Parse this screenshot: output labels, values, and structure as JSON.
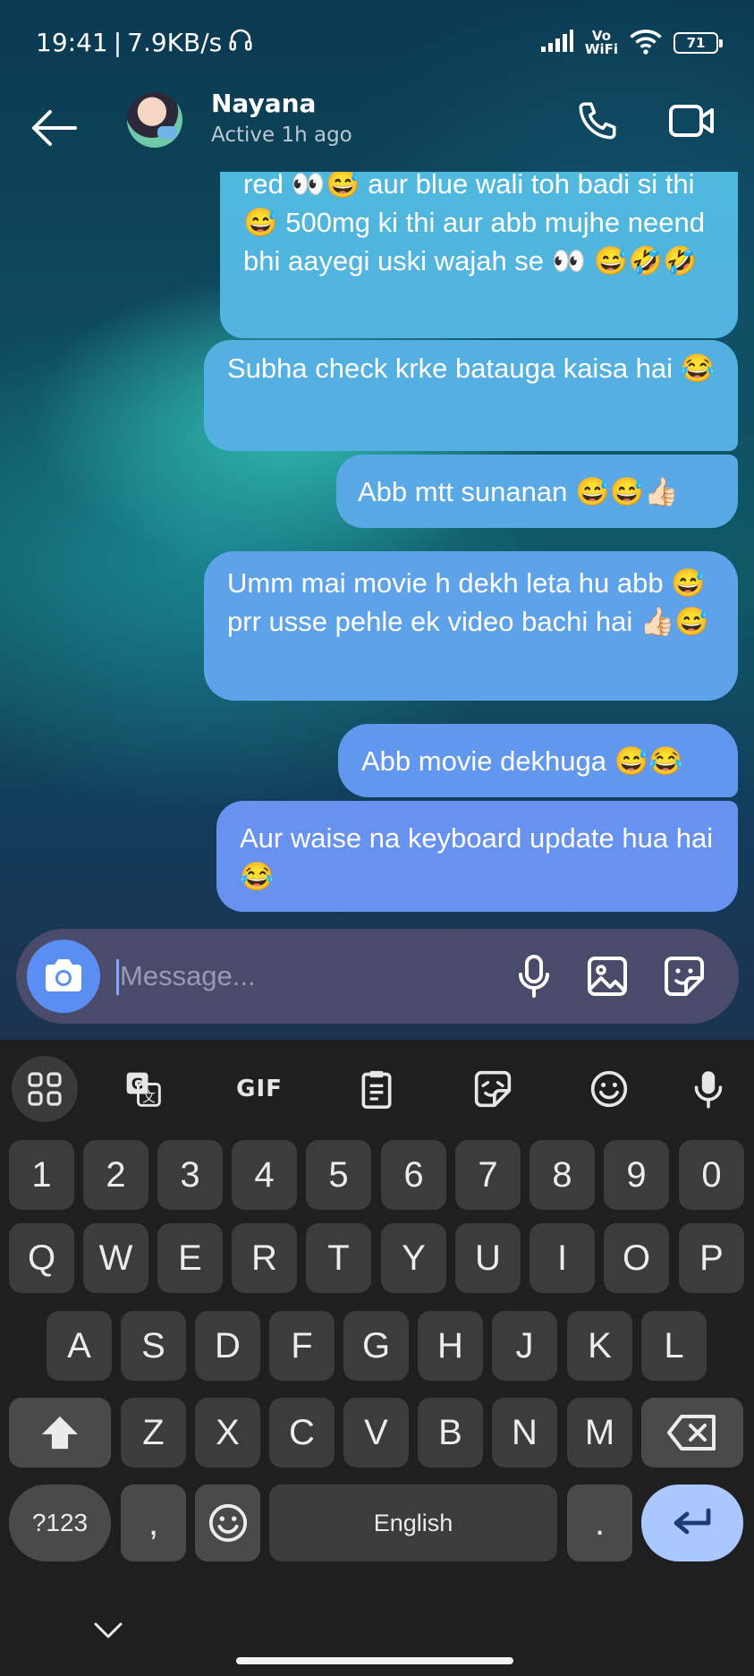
{
  "status_bar": {
    "time": "19:41",
    "separator": "|",
    "speed": "7.9KB/s",
    "vowifi_top": "Vo",
    "vowifi_bottom": "WiFi",
    "battery": "71"
  },
  "header": {
    "contact_name": "Nayana",
    "contact_status": "Active 1h ago"
  },
  "messages": [
    {
      "text": "red 👀😅 aur blue wali toh badi si thi 😅 500mg ki thi aur abb mujhe neend bhi aayegi uski wajah se 👀 😅🤣🤣",
      "sender": "me"
    },
    {
      "text": "Subha check krke batauga kaisa hai 😂",
      "sender": "me"
    },
    {
      "text": "Abb mtt sunanan 😅😅👍🏻",
      "sender": "me"
    },
    {
      "text": "Umm mai movie h dekh leta hu abb 😅 prr usse pehle ek video bachi hai 👍🏻😅",
      "sender": "me"
    },
    {
      "text": "Abb movie dekhuga 😅😂",
      "sender": "me"
    },
    {
      "text": "Aur waise na keyboard update hua hai 😂",
      "sender": "me"
    }
  ],
  "composer": {
    "placeholder": "Message..."
  },
  "keyboard": {
    "toolbar": [
      "apps-icon",
      "translate-icon",
      "GIF",
      "clipboard-icon",
      "sticker-icon",
      "emoji-icon",
      "mic-icon"
    ],
    "gif_label": "GIF",
    "row_numbers": [
      "1",
      "2",
      "3",
      "4",
      "5",
      "6",
      "7",
      "8",
      "9",
      "0"
    ],
    "row_1": [
      "Q",
      "W",
      "E",
      "R",
      "T",
      "Y",
      "U",
      "I",
      "O",
      "P"
    ],
    "row_2": [
      "A",
      "S",
      "D",
      "F",
      "G",
      "H",
      "J",
      "K",
      "L"
    ],
    "row_3": [
      "Z",
      "X",
      "C",
      "V",
      "B",
      "N",
      "M"
    ],
    "symbols_key": "?123",
    "comma_key": ",",
    "space_label": "English",
    "period_key": "."
  },
  "colors": {
    "bubble_top": "#4fb8dd",
    "bubble_bottom": "#6792f0",
    "camera_button": "#5a8ef3",
    "enter_key": "#aac7ff",
    "keyboard_bg": "#1f1f1f"
  }
}
